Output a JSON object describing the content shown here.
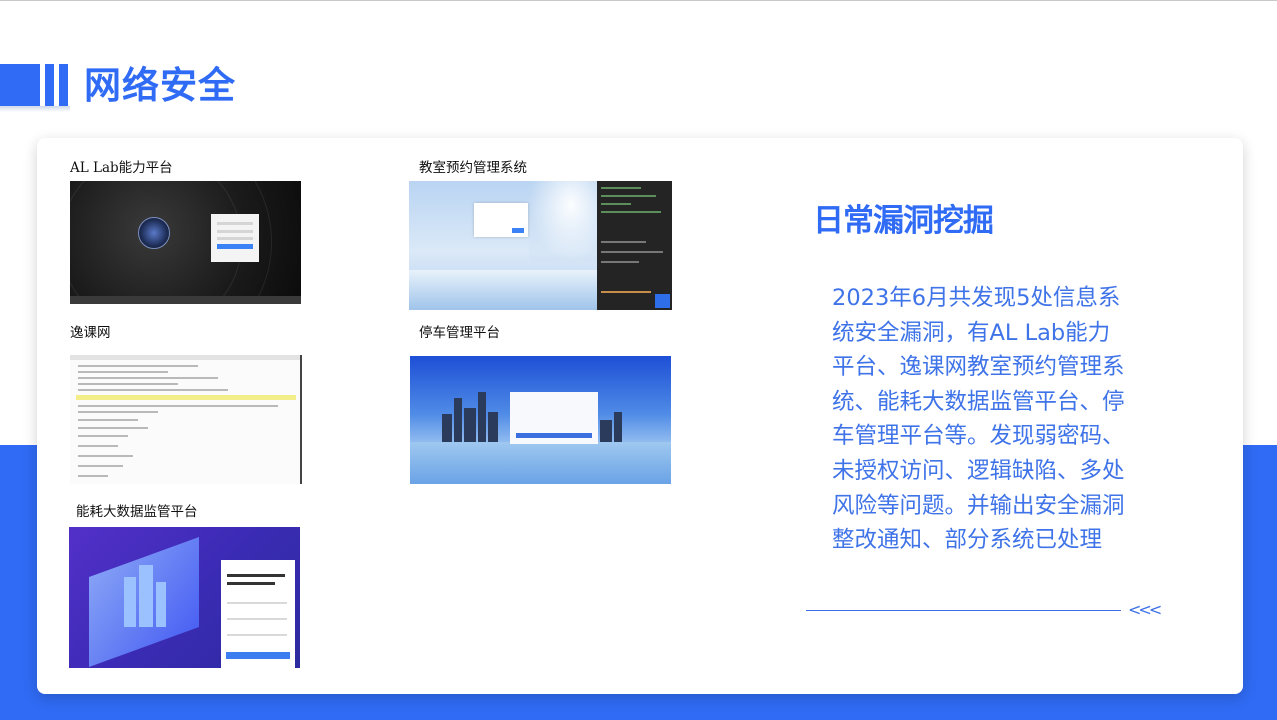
{
  "page": {
    "title": "网络安全",
    "accent_color": "#2f6bf4"
  },
  "gallery": {
    "items": [
      {
        "label": "AL Lab能力平台",
        "image": "login-page-dark-space"
      },
      {
        "label": "教室预约管理系统",
        "image": "login-page-snow-with-devtools"
      },
      {
        "label": "逸课网",
        "image": "code-editor-screenshot"
      },
      {
        "label": "停车管理平台",
        "image": "login-page-city-skyline"
      },
      {
        "label": "能耗大数据监管平台",
        "image": "login-page-isometric-city"
      }
    ]
  },
  "summary": {
    "heading": "日常漏洞挖掘",
    "body": "2023年6月共发现5处信息系统安全漏洞，有AL Lab能力平台、逸课网教室预约管理系统、能耗大数据监管平台、停车管理平台等。发现弱密码、未授权访问、逻辑缺陷、多处风险等问题。并输出安全漏洞整改通知、部分系统已处理",
    "arrow_glyph": "<<<"
  }
}
